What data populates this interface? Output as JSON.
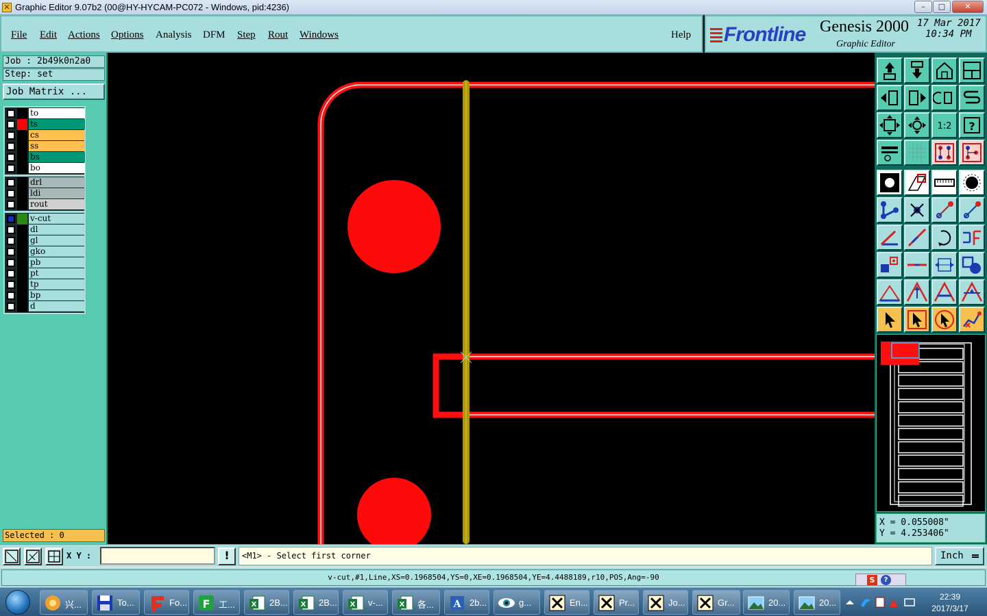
{
  "window": {
    "title": "Graphic Editor 9.07b2 (00@HY-HYCAM-PC072 - Windows, pid:4236)",
    "app_icon": "genesis-x-icon",
    "controls": {
      "minimize": "–",
      "maximize": "□",
      "close": "✕"
    }
  },
  "menu": {
    "items": [
      {
        "label": "File",
        "underline": "F"
      },
      {
        "label": "Edit",
        "underline": "E"
      },
      {
        "label": "Actions",
        "underline": "A"
      },
      {
        "label": "Options",
        "underline": "O"
      },
      {
        "label": "Analysis",
        "underline": "n"
      },
      {
        "label": "DFM",
        "underline": "D"
      },
      {
        "label": "Step",
        "underline": "S"
      },
      {
        "label": "Rout",
        "underline": "R"
      },
      {
        "label": "Windows",
        "underline": "W"
      }
    ],
    "help": "Help"
  },
  "brand": {
    "logo": "Frontline",
    "product": "Genesis 2000",
    "subtitle": "Graphic Editor",
    "date": "17 Mar 2017",
    "time": "10:34 PM"
  },
  "job": {
    "job_label": "Job : 2b49k0n2a0",
    "step_label": "Step: set",
    "matrix_button": "Job Matrix ..."
  },
  "layers": {
    "group1": [
      {
        "name": "to",
        "color": "#ffffff",
        "swatch": "#000000"
      },
      {
        "name": "ts",
        "color": "#009977",
        "swatch": "#ff0000"
      },
      {
        "name": "cs",
        "color": "#ffc050",
        "swatch": "#000000"
      },
      {
        "name": "ss",
        "color": "#ffc050",
        "swatch": "#000000"
      },
      {
        "name": "bs",
        "color": "#009977",
        "swatch": "#000000"
      },
      {
        "name": "bo",
        "color": "#ffffff",
        "swatch": "#000000"
      }
    ],
    "group2": [
      {
        "name": "drl",
        "color": "#a8b8b8",
        "swatch": "#000000"
      },
      {
        "name": "ldi",
        "color": "#a8b8b8",
        "swatch": "#000000"
      },
      {
        "name": "rout",
        "color": "#d0d0d0",
        "swatch": "#000000"
      }
    ],
    "group3": [
      {
        "name": "v-cut",
        "color": "#a8dede",
        "swatch": "#2a8a10",
        "active": true
      },
      {
        "name": "dl",
        "color": "#a8dede",
        "swatch": "#000000"
      },
      {
        "name": "gl",
        "color": "#a8dede",
        "swatch": "#000000"
      },
      {
        "name": "gko",
        "color": "#a8dede",
        "swatch": "#000000"
      },
      {
        "name": "pb",
        "color": "#a8dede",
        "swatch": "#000000"
      },
      {
        "name": "pt",
        "color": "#a8dede",
        "swatch": "#000000"
      },
      {
        "name": "tp",
        "color": "#a8dede",
        "swatch": "#000000"
      },
      {
        "name": "bp",
        "color": "#a8dede",
        "swatch": "#000000"
      },
      {
        "name": "d",
        "color": "#a8dede",
        "swatch": "#000000"
      }
    ]
  },
  "selected_label": "Selected : 0",
  "toolbar": {
    "rows": [
      [
        "layer-up-icon",
        "layer-down-icon",
        "home-icon",
        "split-view-icon"
      ],
      [
        "pan-left-icon",
        "pan-right-icon",
        "rotate-icon",
        "snake-icon"
      ],
      [
        "zoom-fit-icon",
        "zoom-center-icon",
        "ratio-1-2-icon",
        "help-icon"
      ],
      [
        "measure-icon",
        "grid-icon",
        "net-icon",
        "net-select-icon"
      ],
      [
        "feature-pad-icon",
        "select-area-icon",
        "ruler-icon",
        "pad-icon"
      ],
      [
        "snap-node-icon",
        "snap-center-icon",
        "snap-line-icon",
        "snap-point-icon"
      ],
      [
        "angle-icon",
        "line-angle-icon",
        "arc-icon",
        "mirror-icon"
      ],
      [
        "intersect-icon",
        "line-split-icon",
        "fit-width-icon",
        "shapes-icon"
      ],
      [
        "drc-triangle-icon",
        "drc-arrow-icon",
        "drc-line-icon",
        "drc-mark-icon"
      ],
      [
        "pointer-icon",
        "select-pointer-icon",
        "clock-pointer-icon",
        "route-icon"
      ]
    ],
    "ratio_text": "1:2",
    "help_text": "?"
  },
  "coords": {
    "x": "X = 0.055008\"",
    "y": "Y = 4.253406\""
  },
  "command": {
    "xy_label": "X Y :",
    "xy_value": "",
    "warn": "!",
    "prompt": "<M1> - Select first corner",
    "unit": "Inch"
  },
  "status": "v-cut,#1,Line,XS=0.1968504,YS=0,XE=0.1968504,YE=4.4488189,r10,POS,Ang=-90",
  "ime": {
    "s": "S",
    "q": "?"
  },
  "taskbar": {
    "items": [
      {
        "label": "兴...",
        "icon": "shell-icon"
      },
      {
        "label": "To...",
        "icon": "floppy-icon"
      },
      {
        "label": "Fo...",
        "icon": "foxit-icon"
      },
      {
        "label": "工...",
        "icon": "flash-icon"
      },
      {
        "label": "2B...",
        "icon": "excel-icon"
      },
      {
        "label": "2B...",
        "icon": "excel-icon"
      },
      {
        "label": "v-...",
        "icon": "excel-icon"
      },
      {
        "label": "各...",
        "icon": "excel-icon"
      },
      {
        "label": "2b...",
        "icon": "word-icon"
      },
      {
        "label": "g...",
        "icon": "eye-icon"
      },
      {
        "label": "En...",
        "icon": "genesis-x-icon"
      },
      {
        "label": "Pr...",
        "icon": "genesis-x-icon"
      },
      {
        "label": "Jo...",
        "icon": "genesis-x-icon"
      },
      {
        "label": "Gr...",
        "icon": "genesis-x-icon"
      },
      {
        "label": "20...",
        "icon": "picture-icon"
      },
      {
        "label": "20...",
        "icon": "picture-icon"
      }
    ],
    "time": "22:39",
    "date": "2017/3/17"
  }
}
